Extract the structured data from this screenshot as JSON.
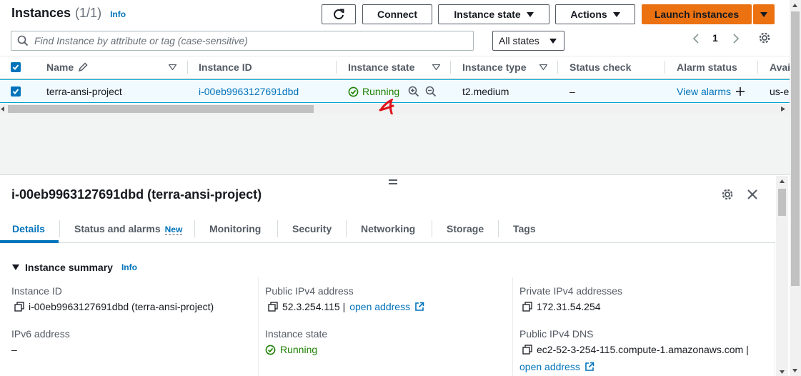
{
  "header": {
    "title": "Instances",
    "count": "(1/1)",
    "info": "Info",
    "connect": "Connect",
    "instance_state": "Instance state",
    "actions": "Actions",
    "launch": "Launch instances"
  },
  "filter": {
    "placeholder": "Find Instance by attribute or tag (case-sensitive)",
    "states": "All states",
    "page": "1"
  },
  "table": {
    "columns": [
      "Name",
      "Instance ID",
      "Instance state",
      "Instance type",
      "Status check",
      "Alarm status",
      "Avai"
    ],
    "row": {
      "name": "terra-ansi-project",
      "id": "i-00eb9963127691dbd",
      "state": "Running",
      "type": "t2.medium",
      "status_check": "–",
      "alarm": "View alarms",
      "zone": "us-e"
    }
  },
  "detail": {
    "title": "i-00eb9963127691dbd (terra-ansi-project)",
    "tabs": [
      "Details",
      "Status and alarms",
      "Monitoring",
      "Security",
      "Networking",
      "Storage",
      "Tags"
    ],
    "new_badge": "New",
    "section": "Instance summary",
    "section_info": "Info",
    "instance_id_label": "Instance ID",
    "instance_id_value": "i-00eb9963127691dbd (terra-ansi-project)",
    "ipv6_label": "IPv6 address",
    "ipv6_value": "–",
    "public_ip_label": "Public IPv4 address",
    "public_ip_value": "52.3.254.115 |",
    "open_address": "open address",
    "state_label": "Instance state",
    "state_value": "Running",
    "private_ip_label": "Private IPv4 addresses",
    "private_ip_value": "172.31.54.254",
    "dns_label": "Public IPv4 DNS",
    "dns_value": "ec2-52-3-254-115.compute-1.amazonaws.com |",
    "open_address2": "open address"
  },
  "colors": {
    "accent": "#0073bb",
    "launch_bg": "#ec7211",
    "running": "#1d8102",
    "annotation": "#e0101a"
  }
}
